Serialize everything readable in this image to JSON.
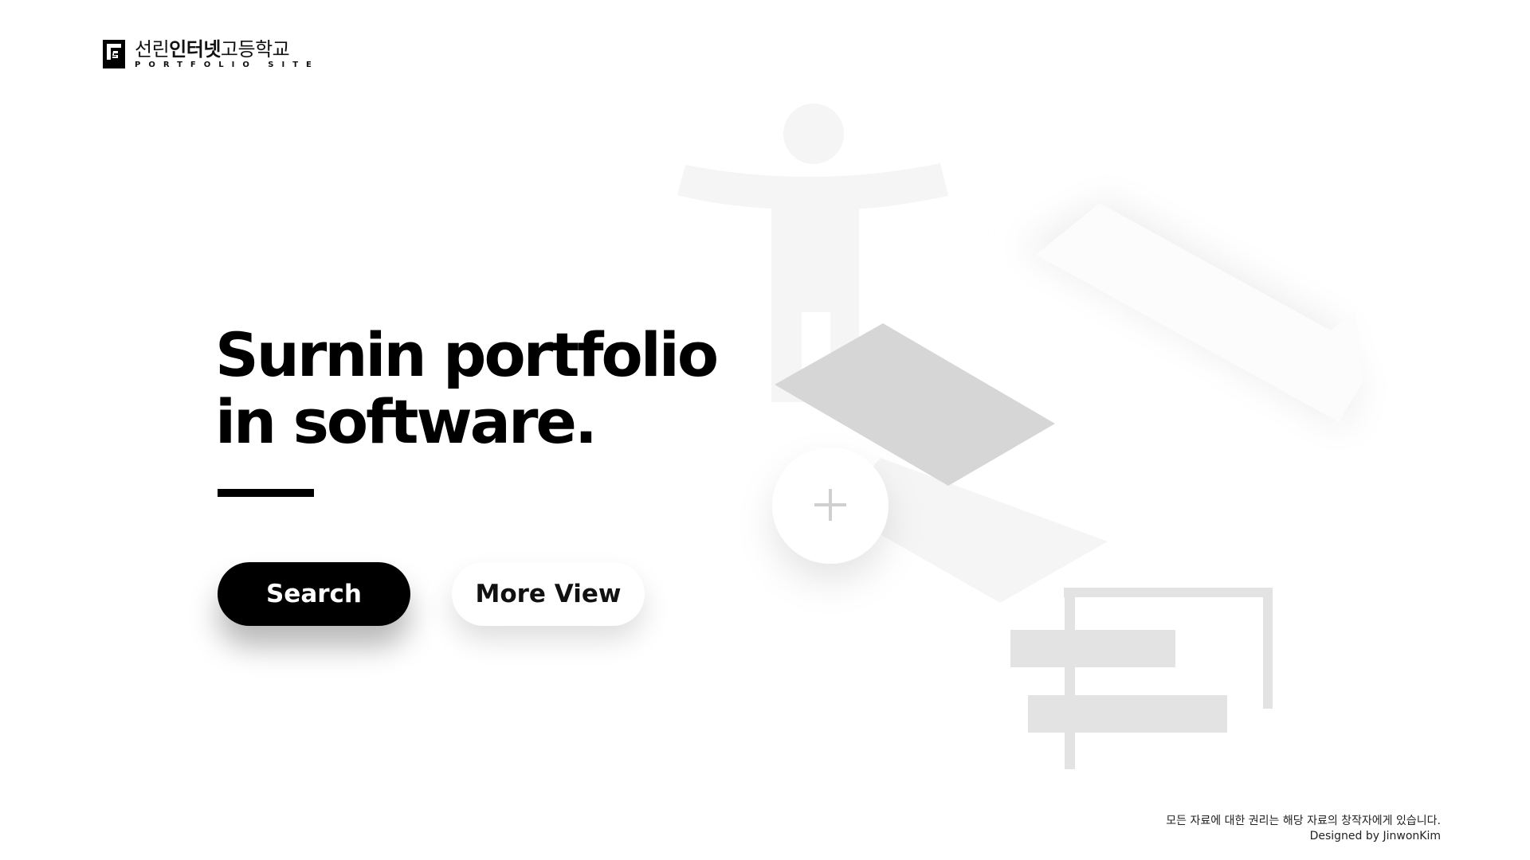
{
  "header": {
    "logo_icon": "school-logo-icon",
    "school_name_light_1": "선린",
    "school_name_bold": "인터넷",
    "school_name_light_2": "고등학교",
    "subtitle": "PORTFOLIO SITE"
  },
  "hero": {
    "title_line1": "Surnin portfolio",
    "title_line2": "in software.",
    "search_label": "Search",
    "more_view_label": "More View"
  },
  "illustration": {
    "plus_icon": "plus-icon",
    "colors": {
      "light": "#f5f5f5",
      "mid": "#e3e3e3",
      "dark": "#d6d6d6"
    }
  },
  "footer": {
    "rights_text": "모든 자료에 대한 권리는 해당 자료의 창작자에게 있습니다.",
    "credit": "Designed by JinwonKim"
  }
}
